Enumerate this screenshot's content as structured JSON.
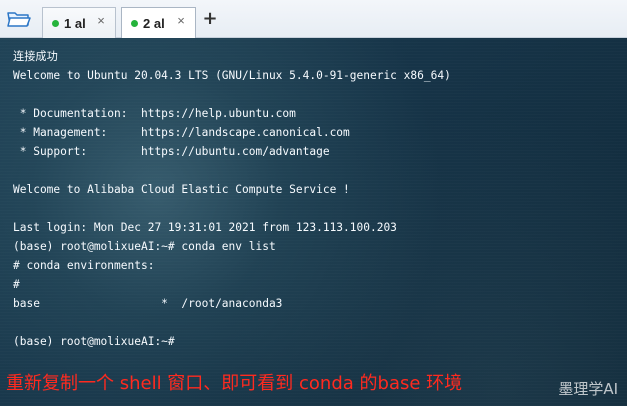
{
  "tabs": [
    {
      "label": "1 al",
      "close_label": "×",
      "active": false
    },
    {
      "label": "2 al",
      "close_label": "×",
      "active": true
    }
  ],
  "new_tab_label": "+",
  "terminal": {
    "lines": [
      "连接成功",
      "Welcome to Ubuntu 20.04.3 LTS (GNU/Linux 5.4.0-91-generic x86_64)",
      "",
      " * Documentation:  https://help.ubuntu.com",
      " * Management:     https://landscape.canonical.com",
      " * Support:        https://ubuntu.com/advantage",
      "",
      "Welcome to Alibaba Cloud Elastic Compute Service !",
      "",
      "Last login: Mon Dec 27 19:31:01 2021 from 123.113.100.203",
      "(base) root@molixueAI:~# conda env list",
      "# conda environments:",
      "#",
      "base                  *  /root/anaconda3",
      "",
      "(base) root@molixueAI:~#"
    ]
  },
  "caption": "重新复制一个 shell 窗口、即可看到 conda 的base 环境",
  "watermark": "墨理学AI",
  "colors": {
    "active_dot": "#25b33b",
    "caption": "#ff2a1f",
    "terminal_text": "#f7fbff"
  },
  "icons": {
    "open_folder": "folder-open-icon",
    "tab_status": "green-dot-icon",
    "tab_close": "close-icon",
    "new_tab": "plus-icon"
  }
}
